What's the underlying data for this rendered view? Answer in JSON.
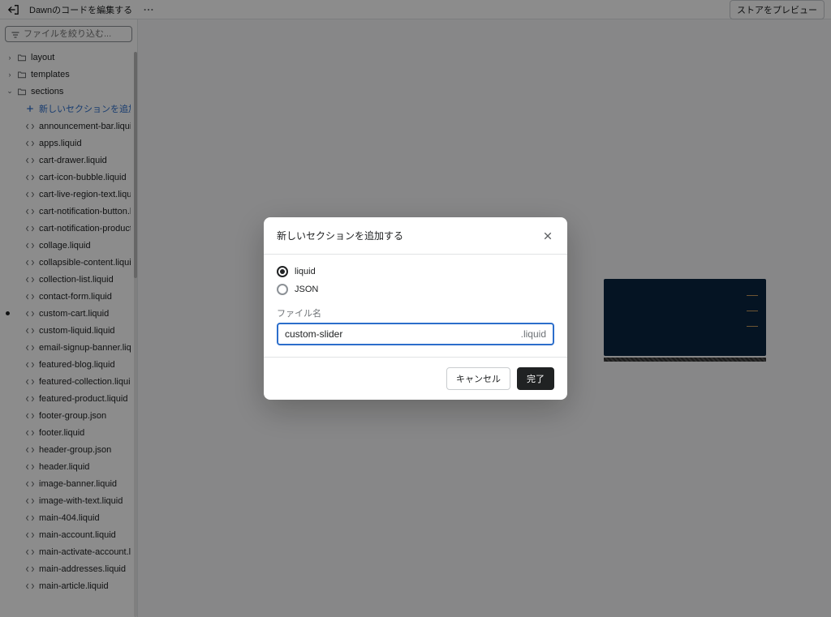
{
  "header": {
    "title": "Dawnのコードを編集する",
    "preview_button": "ストアをプレビュー"
  },
  "sidebar": {
    "filter_placeholder": "ファイルを絞り込む...",
    "folders": [
      {
        "name": "layout",
        "expanded": false
      },
      {
        "name": "templates",
        "expanded": false
      }
    ],
    "sections_folder": {
      "name": "sections",
      "add_label": "新しいセクションを追加する",
      "files": [
        "announcement-bar.liquid",
        "apps.liquid",
        "cart-drawer.liquid",
        "cart-icon-bubble.liquid",
        "cart-live-region-text.liquid",
        "cart-notification-button.liquid",
        "cart-notification-product.liquid",
        "collage.liquid",
        "collapsible-content.liquid",
        "collection-list.liquid",
        "contact-form.liquid",
        "custom-cart.liquid",
        "custom-liquid.liquid",
        "email-signup-banner.liquid",
        "featured-blog.liquid",
        "featured-collection.liquid",
        "featured-product.liquid",
        "footer-group.json",
        "footer.liquid",
        "header-group.json",
        "header.liquid",
        "image-banner.liquid",
        "image-with-text.liquid",
        "main-404.liquid",
        "main-account.liquid",
        "main-activate-account.liquid",
        "main-addresses.liquid",
        "main-article.liquid"
      ],
      "active_index": 11
    }
  },
  "modal": {
    "title": "新しいセクションを追加する",
    "option_liquid": "liquid",
    "option_json": "JSON",
    "field_label": "ファイル名",
    "field_value": "custom-slider",
    "field_suffix": ".liquid",
    "cancel": "キャンセル",
    "done": "完了"
  }
}
